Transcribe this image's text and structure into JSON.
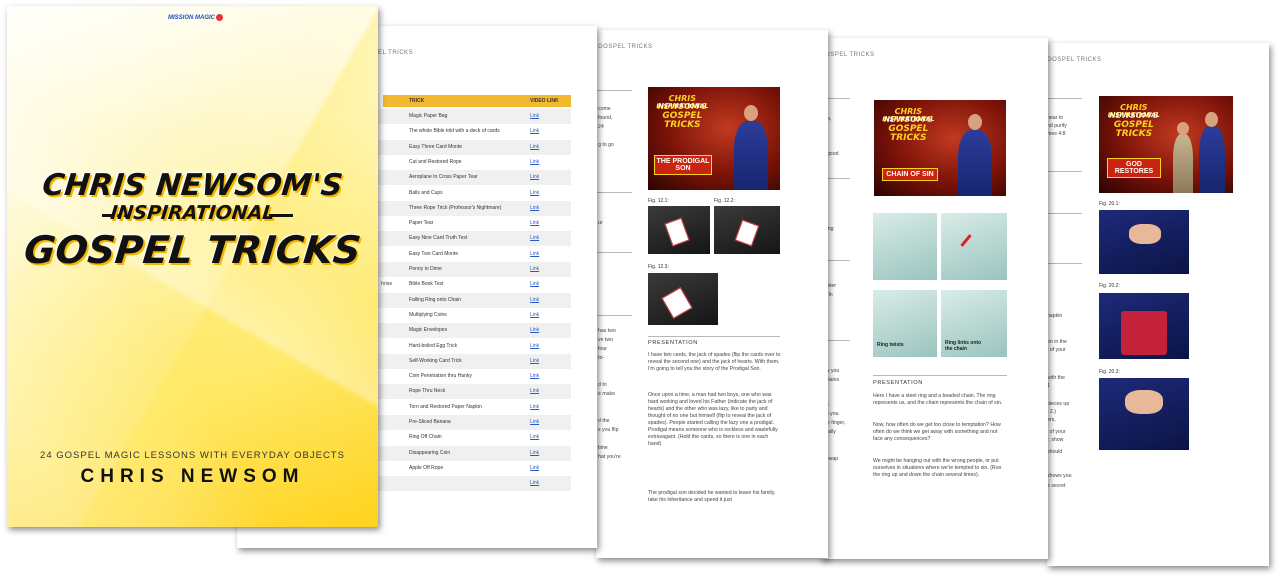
{
  "cover": {
    "logo": "MISSION MAGIC",
    "title_line1": "CHRIS NEWSOM'S",
    "title_line2": "INSPIRATIONAL",
    "title_line3": "GOSPEL TRICKS",
    "subtitle": "24 GOSPEL MAGIC LESSONS WITH EVERYDAY OBJECTS",
    "author": "CHRIS NEWSOM"
  },
  "toc": {
    "header": "SPEL TRICKS",
    "columns": [
      "TRICK",
      "VIDEO LINK"
    ],
    "link_label": "Link",
    "rows": [
      "Magic Paper Bag",
      "The whole Bible told with a deck of cards",
      "Easy Three Card Monte",
      "Cut and Restored Rope",
      "Aeroplane to Cross Paper Tear",
      "Balls and Cups",
      "Three Rope Trick (Professor's Nightmare)",
      "Paper Tear",
      "Easy Nine Card Truth Test",
      "Easy Two Card Monte",
      "Penny to Dime",
      "Bible Book Test",
      "Falling Ring onto Chain",
      "Multiplying Coins",
      "Magic Envelopes",
      "Hard-boiled Egg Trick",
      "Self-Working Card Trick",
      "Coin Penetration thru Hanky",
      "Rope Thru Neck",
      "Torn and Restored Paper Napkin",
      "Pre-Sliced Banana",
      "Ring Off Chain",
      "Disappearing Coin",
      "Apple Off Rope",
      ""
    ],
    "left_fragments": [
      "en",
      "hrise"
    ]
  },
  "page3": {
    "header": "GOSPEL TRICKS",
    "banner_title": [
      "CHRIS NEWSOM'S",
      "INSPIRATIONAL",
      "GOSPEL TRICKS"
    ],
    "banner_sub": "THE PRODIGAL SON",
    "figs": [
      "Fig. 12.1:",
      "Fig. 12.2:",
      "Fig. 12.3:"
    ],
    "presentation": "PRESENTATION",
    "paragraphs": [
      "I have two cards, the jack of spades (flip the cards over to reveal the second one) and the jack of hearts. With them, I'm going to tell you the story of the Prodigal Son.",
      "Once upon a time, a man had two boys, one who was hard working and loved his Father (indicate the jack of hearts) and the other who was lazy, like to party and thought of no one but himself (flip to reveal the jack of spades). People started calling the lazy one a prodigal. Prodigal means someone who is reckless and wastefully extravagant. (Hold the cards, so there is one in each hand)",
      "The prodigal son decided he wanted to leave his family, take his inheritance and spend it just"
    ],
    "left_fragments": [
      "come",
      "found,",
      "24",
      "g to go",
      "ur",
      "has two",
      "ve two",
      "four",
      "to-",
      "d to",
      "e make",
      "d the",
      "s you flip",
      "time",
      "hat you're"
    ]
  },
  "page4": {
    "header": "GOSPEL TRICKS",
    "banner_title": [
      "CHRIS NEWSOM'S",
      "INSPIRATIONAL",
      "GOSPEL TRICKS"
    ],
    "banner_sub": "CHAIN OF SIN",
    "photo_labels": [
      "Ring twists",
      "Ring links onto the chain"
    ],
    "presentation": "PRESENTATION",
    "paragraphs": [
      "Here I have a steel ring and a beaded chain. The ring represents us, and the chain represents the chain of sin.",
      "Now, how often do we get too close to temptation? How often do we think we get away with something and not face any consequences?",
      "We might be hanging out with the wrong people, or put ourselves in situations where we're tempted to sin. (Run the ring up and down the chain several times)."
    ],
    "left_fragments": [
      "hem,",
      "ds good",
      "falling",
      "ameter",
      "by (ln",
      "how you",
      "explains",
      "ring",
      "hen you",
      "ddle finger,",
      "atically",
      "or swap",
      "off"
    ]
  },
  "page5": {
    "header": "GOSPEL TRICKS",
    "banner_title": [
      "CHRIS NEWSOM'S",
      "INSPIRATIONAL",
      "GOSPEL TRICKS"
    ],
    "banner_sub": "GOD RESTORES",
    "figs": [
      "Fig. 20.1:",
      "Fig. 20.2:",
      "Fig. 20.3:"
    ],
    "left_fragments": [
      "near to",
      "nd purify",
      "mes 4:8",
      "napkin",
      "on in the",
      "t of your",
      "with the",
      "1",
      "pieces up",
      "t 2.)",
      "ers,",
      "l of your",
      "r, show",
      "should",
      "shows you",
      "e secret"
    ]
  }
}
